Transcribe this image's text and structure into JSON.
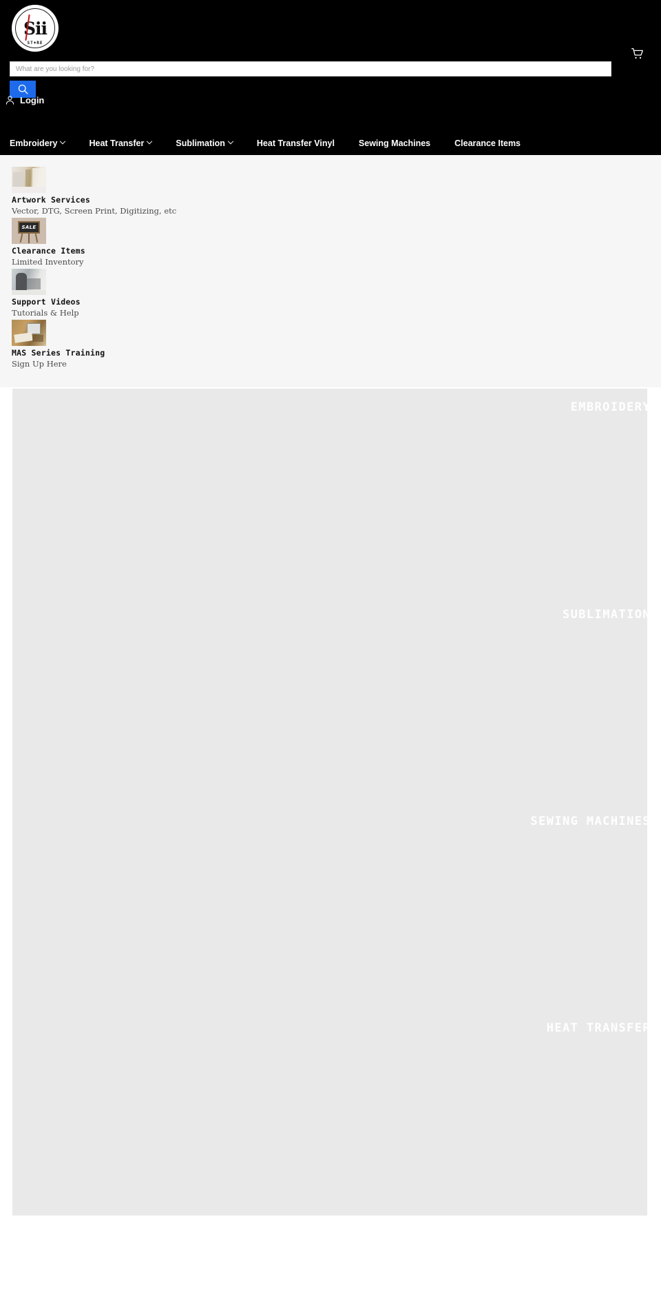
{
  "header": {
    "logo": {
      "name": "Sii Store",
      "mark_text": "Sii",
      "sub_text": "ST♦RE"
    },
    "search": {
      "placeholder": "What are you looking for?",
      "value": "",
      "button_icon": "search-icon"
    },
    "cart": {
      "icon": "shopping-cart-icon",
      "label": ""
    },
    "account": {
      "icon": "user-icon",
      "label": "Login"
    },
    "nav": [
      {
        "label": "Embroidery",
        "has_dropdown": true
      },
      {
        "label": "Heat Transfer",
        "has_dropdown": true
      },
      {
        "label": "Sublimation",
        "has_dropdown": true
      },
      {
        "label": "Heat Transfer Vinyl",
        "has_dropdown": false
      },
      {
        "label": "Sewing Machines",
        "has_dropdown": false
      },
      {
        "label": "Clearance Items",
        "has_dropdown": false
      }
    ],
    "background_color": "#000000"
  },
  "services": {
    "background_color": "#f6f6f6",
    "items": [
      {
        "title": "Artwork Services",
        "desc": "Vector, DTG, Screen Print, Digitizing, etc",
        "thumb": "artwork-desk-thumbnail"
      },
      {
        "title": "Clearance Items",
        "desc": "Limited Inventory",
        "thumb": "sale-easel-thumbnail",
        "thumb_text": "SALE"
      },
      {
        "title": "Support Videos",
        "desc": "Tutorials & Help",
        "thumb": "support-video-thumbnail"
      },
      {
        "title": "MAS Series Training",
        "desc": "Sign Up Here",
        "thumb": "mas-training-thumbnail"
      }
    ]
  },
  "categories": {
    "panel_color": "#e9e9e9",
    "label_color": "#ffffff",
    "items": [
      {
        "label": "EMBROIDERY"
      },
      {
        "label": "SUBLIMATION"
      },
      {
        "label": "SEWING MACHINES"
      },
      {
        "label": "HEAT TRANSFER"
      }
    ]
  }
}
